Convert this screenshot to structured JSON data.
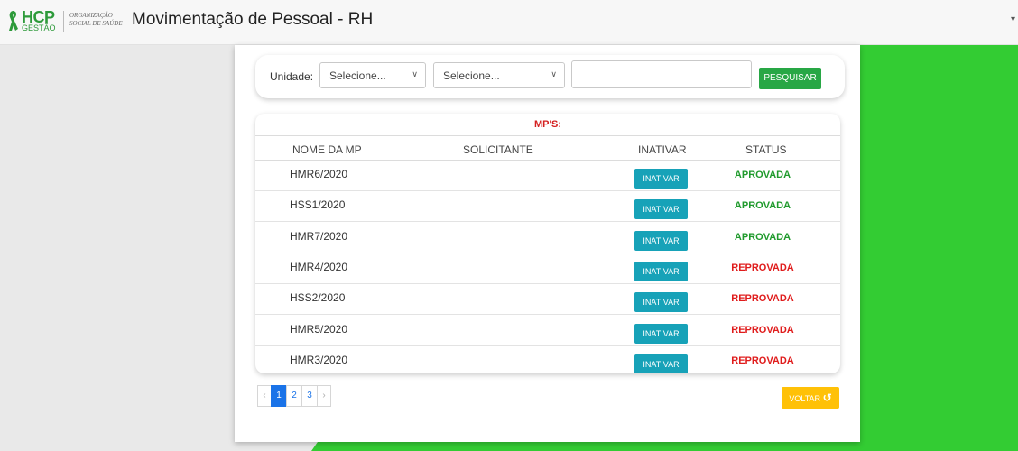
{
  "header": {
    "logo_main": "HCP",
    "logo_sub": "GESTÃO",
    "org_line1": "ORGANIZAÇÃO",
    "org_line2": "SOCIAL DE SAÚDE",
    "title": "Movimentação de Pessoal - RH"
  },
  "filter": {
    "unit_label": "Unidade:",
    "select1": "Selecione...",
    "select2": "Selecione...",
    "text_value": "",
    "search_label": "PESQUISAR"
  },
  "table": {
    "caption": "MP'S:",
    "columns": [
      "NOME DA MP",
      "SOLICITANTE",
      "INATIVAR",
      "STATUS"
    ],
    "rows": [
      {
        "name": "HMR6/2020",
        "solicitante": "",
        "action": "INATIVAR",
        "status": "APROVADA"
      },
      {
        "name": "HSS1/2020",
        "solicitante": "",
        "action": "INATIVAR",
        "status": "APROVADA"
      },
      {
        "name": "HMR7/2020",
        "solicitante": "",
        "action": "INATIVAR",
        "status": "APROVADA"
      },
      {
        "name": "HMR4/2020",
        "solicitante": "",
        "action": "INATIVAR",
        "status": "REPROVADA"
      },
      {
        "name": "HSS2/2020",
        "solicitante": "",
        "action": "INATIVAR",
        "status": "REPROVADA"
      },
      {
        "name": "HMR5/2020",
        "solicitante": "",
        "action": "INATIVAR",
        "status": "REPROVADA"
      },
      {
        "name": "HMR3/2020",
        "solicitante": "",
        "action": "INATIVAR",
        "status": "REPROVADA"
      }
    ]
  },
  "pagination": {
    "prev": "‹",
    "pages": [
      "1",
      "2",
      "3"
    ],
    "active": "1",
    "next": "›"
  },
  "back_label": "VOLTAR",
  "colors": {
    "brand_green": "#2d9a3a",
    "bg_green": "#33cc33",
    "search_button": "#28a745",
    "inativar_button": "#17a2b8",
    "approved": "#1f9a2c",
    "rejected": "#e01c1c",
    "back_button": "#ffc107",
    "page_active": "#1a73e8"
  }
}
